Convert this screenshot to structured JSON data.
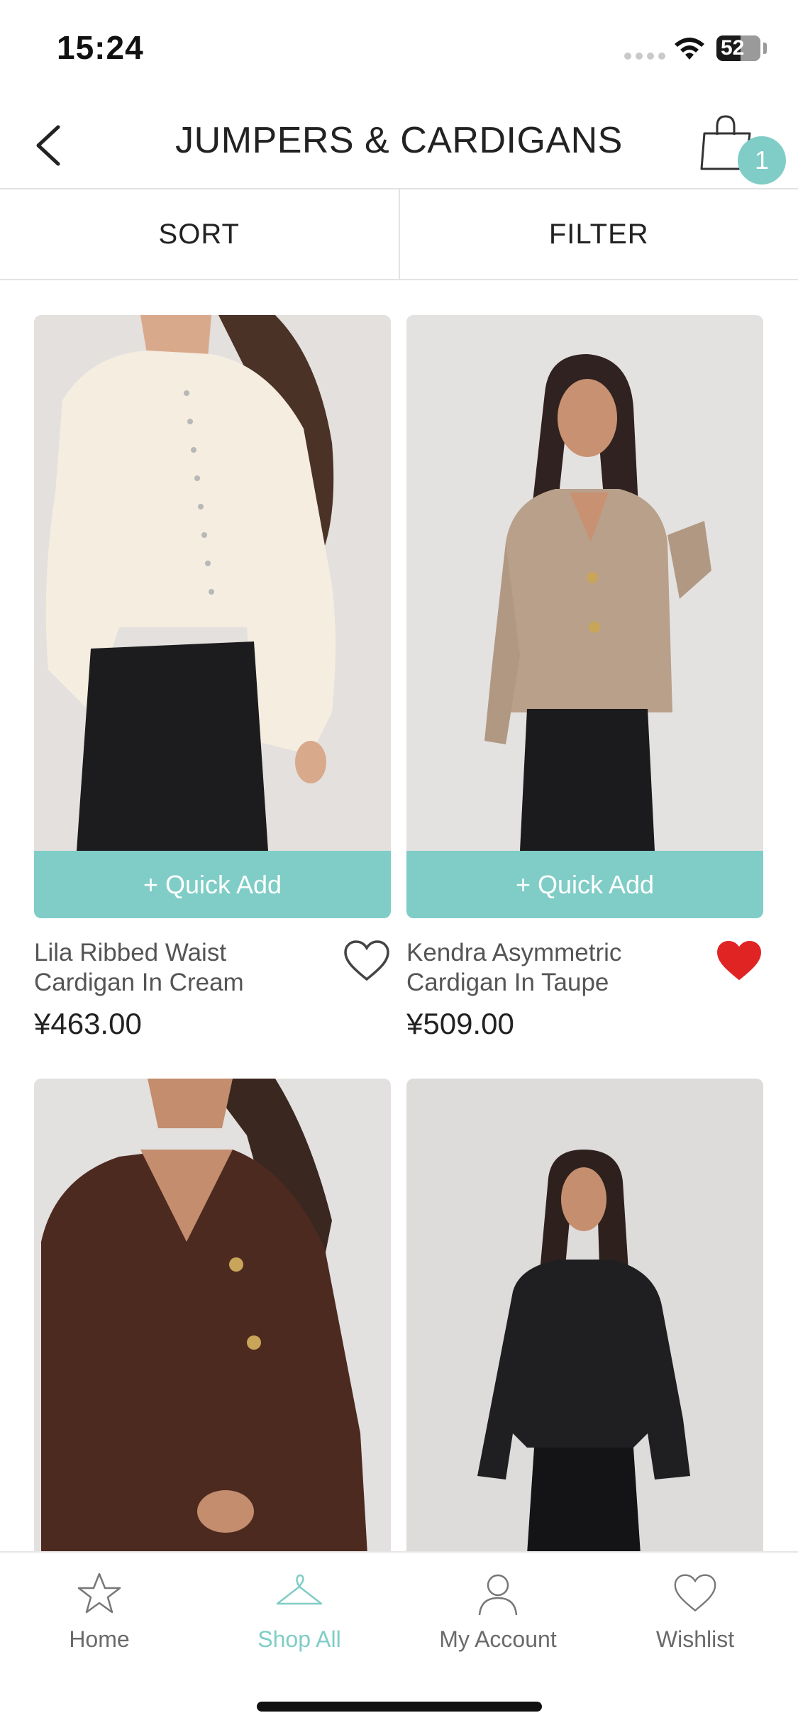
{
  "status_bar": {
    "time": "15:24",
    "battery": "52"
  },
  "header": {
    "title": "JUMPERS & CARDIGANS",
    "cart_count": "1"
  },
  "toolbar": {
    "sort_label": "SORT",
    "filter_label": "FILTER"
  },
  "products": [
    {
      "name": "Lila Ribbed Waist Cardigan In Cream",
      "price": "¥463.00",
      "quick_add": "+ Quick Add",
      "wishlisted": false
    },
    {
      "name": "Kendra Asymmetric Cardigan In Taupe",
      "price": "¥509.00",
      "quick_add": "+ Quick Add",
      "wishlisted": true
    },
    {
      "name": "",
      "price": "",
      "quick_add": "",
      "wishlisted": false
    },
    {
      "name": "",
      "price": "",
      "quick_add": "",
      "wishlisted": false
    }
  ],
  "bottom_nav": {
    "items": [
      {
        "label": "Home",
        "icon": "star-icon",
        "active": false
      },
      {
        "label": "Shop All",
        "icon": "hanger-icon",
        "active": true
      },
      {
        "label": "My Account",
        "icon": "person-icon",
        "active": false
      },
      {
        "label": "Wishlist",
        "icon": "heart-icon",
        "active": false
      }
    ]
  },
  "colors": {
    "accent": "#7fcdc6",
    "wishlist_red": "#e02424",
    "text_dark": "#222222",
    "text_muted": "#555555"
  }
}
